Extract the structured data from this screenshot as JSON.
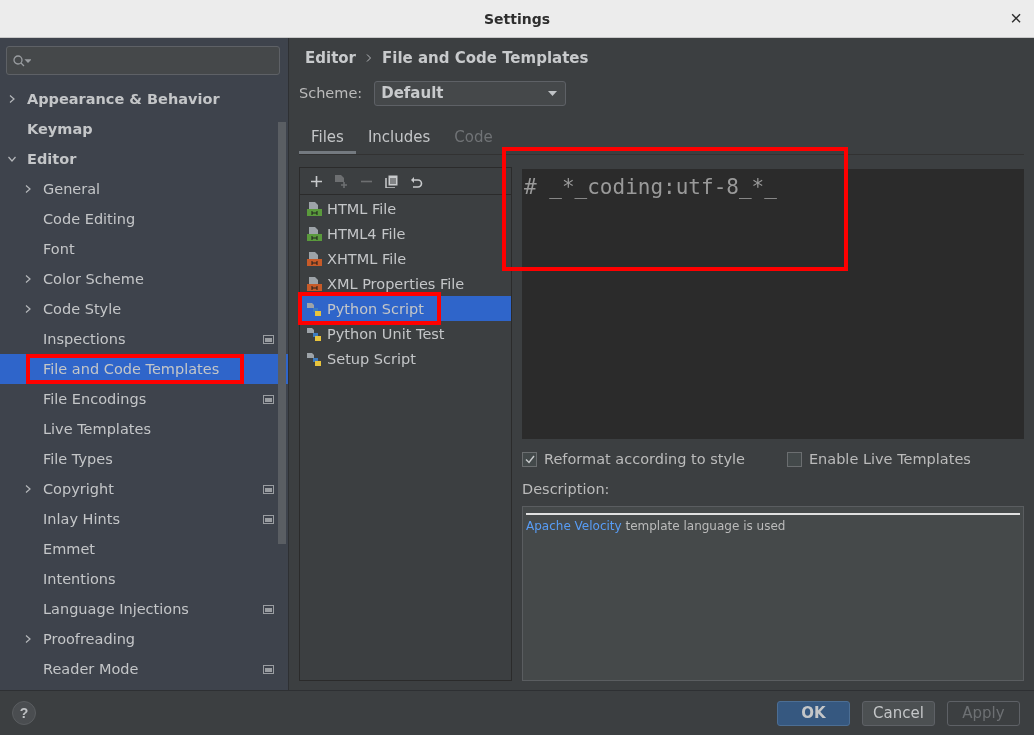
{
  "window": {
    "title": "Settings",
    "close": "×"
  },
  "sidebar": {
    "items": [
      {
        "label": "Appearance & Behavior",
        "expanded": false,
        "selected": false,
        "badge": false,
        "highlighted": false
      },
      {
        "label": "Keymap",
        "selected": false,
        "badge": false,
        "highlighted": false
      },
      {
        "label": "Editor",
        "expanded": true,
        "selected": false,
        "badge": false,
        "highlighted": false,
        "children": [
          {
            "label": "General",
            "expanded": false,
            "selected": false,
            "badge": false,
            "highlighted": false
          },
          {
            "label": "Code Editing",
            "selected": false,
            "badge": false,
            "highlighted": false
          },
          {
            "label": "Font",
            "selected": false,
            "badge": false,
            "highlighted": false
          },
          {
            "label": "Color Scheme",
            "expanded": false,
            "selected": false,
            "badge": false,
            "highlighted": false
          },
          {
            "label": "Code Style",
            "expanded": false,
            "selected": false,
            "badge": false,
            "highlighted": false
          },
          {
            "label": "Inspections",
            "selected": false,
            "badge": true,
            "highlighted": false
          },
          {
            "label": "File and Code Templates",
            "selected": true,
            "badge": false,
            "highlighted": true
          },
          {
            "label": "File Encodings",
            "selected": false,
            "badge": true,
            "highlighted": false
          },
          {
            "label": "Live Templates",
            "selected": false,
            "badge": false,
            "highlighted": false
          },
          {
            "label": "File Types",
            "selected": false,
            "badge": false,
            "highlighted": false
          },
          {
            "label": "Copyright",
            "expanded": false,
            "selected": false,
            "badge": true,
            "highlighted": false
          },
          {
            "label": "Inlay Hints",
            "selected": false,
            "badge": true,
            "highlighted": false
          },
          {
            "label": "Emmet",
            "selected": false,
            "badge": false,
            "highlighted": false
          },
          {
            "label": "Intentions",
            "selected": false,
            "badge": false,
            "highlighted": false
          },
          {
            "label": "Language Injections",
            "selected": false,
            "badge": true,
            "highlighted": false
          },
          {
            "label": "Proofreading",
            "expanded": false,
            "selected": false,
            "badge": false,
            "highlighted": false
          },
          {
            "label": "Reader Mode",
            "selected": false,
            "badge": true,
            "highlighted": false
          }
        ]
      }
    ]
  },
  "breadcrumb": [
    "Editor",
    "File and Code Templates"
  ],
  "scheme": {
    "label": "Scheme:",
    "value": "Default"
  },
  "tabs": [
    {
      "label": "Files",
      "selected": true,
      "disabled": false
    },
    {
      "label": "Includes",
      "selected": false,
      "disabled": false
    },
    {
      "label": "Code",
      "selected": false,
      "disabled": true
    }
  ],
  "toolbar": [
    {
      "kind": "add",
      "disabled": false
    },
    {
      "kind": "add-child",
      "disabled": true
    },
    {
      "kind": "remove",
      "disabled": true
    },
    {
      "kind": "copy",
      "disabled": false
    },
    {
      "kind": "reset",
      "disabled": false
    }
  ],
  "templates": [
    {
      "label": "HTML File",
      "kind": "html",
      "selected": false,
      "highlighted": false
    },
    {
      "label": "HTML4 File",
      "kind": "html",
      "selected": false,
      "highlighted": false
    },
    {
      "label": "XHTML File",
      "kind": "xhtml",
      "selected": false,
      "highlighted": false
    },
    {
      "label": "XML Properties File",
      "kind": "xml",
      "selected": false,
      "highlighted": false
    },
    {
      "label": "Python Script",
      "kind": "python",
      "selected": true,
      "highlighted": true
    },
    {
      "label": "Python Unit Test",
      "kind": "python",
      "selected": false,
      "highlighted": false
    },
    {
      "label": "Setup Script",
      "kind": "python",
      "selected": false,
      "highlighted": false
    }
  ],
  "template_editor": {
    "code": "# _*_coding:utf-8_*_",
    "highlighted": true
  },
  "options": [
    {
      "label": "Reformat according to style",
      "checked": true
    },
    {
      "label": "Enable Live Templates",
      "checked": false
    }
  ],
  "description": {
    "label": "Description:",
    "link": "Apache Velocity",
    "text": " template language is used"
  },
  "help": "?",
  "buttons": [
    {
      "label": "OK",
      "kind": "primary",
      "disabled": false
    },
    {
      "label": "Cancel",
      "kind": "normal",
      "disabled": false
    },
    {
      "label": "Apply",
      "kind": "normal",
      "disabled": true
    }
  ]
}
